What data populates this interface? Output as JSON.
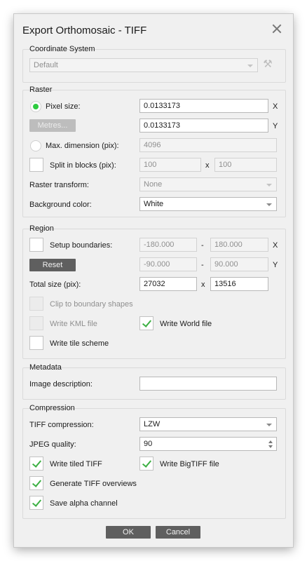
{
  "dialog": {
    "title": "Export Orthomosaic - TIFF",
    "ok_label": "OK",
    "cancel_label": "Cancel"
  },
  "coordinate_system": {
    "group_label": "Coordinate System",
    "value": "Default"
  },
  "raster": {
    "group_label": "Raster",
    "pixel_size_label": "Pixel size:",
    "pixel_size_selected": true,
    "pixel_x": "0.0133173",
    "pixel_y": "0.0133173",
    "metres_button": "Metres...",
    "x_axis": "X",
    "y_axis": "Y",
    "max_dimension_label": "Max. dimension (pix):",
    "max_dimension_value": "4096",
    "split_blocks_label": "Split in blocks (pix):",
    "split_x": "100",
    "split_sep": "x",
    "split_y": "100",
    "raster_transform_label": "Raster transform:",
    "raster_transform_value": "None",
    "background_color_label": "Background color:",
    "background_color_value": "White"
  },
  "region": {
    "group_label": "Region",
    "setup_boundaries_label": "Setup boundaries:",
    "x_min": "-180.000",
    "x_max": "180.000",
    "dash": "-",
    "x_axis": "X",
    "reset_button": "Reset",
    "y_min": "-90.000",
    "y_max": "90.000",
    "y_axis": "Y",
    "total_size_label": "Total size (pix):",
    "total_w": "27032",
    "total_sep": "x",
    "total_h": "13516",
    "clip_label": "Clip to boundary shapes",
    "kml_label": "Write KML file",
    "world_file_label": "Write World file",
    "world_file_checked": true,
    "tile_scheme_label": "Write tile scheme"
  },
  "metadata": {
    "group_label": "Metadata",
    "image_description_label": "Image description:",
    "image_description_value": ""
  },
  "compression": {
    "group_label": "Compression",
    "tiff_compression_label": "TIFF compression:",
    "tiff_compression_value": "LZW",
    "jpeg_quality_label": "JPEG quality:",
    "jpeg_quality_value": "90",
    "write_tiled_label": "Write tiled TIFF",
    "write_bigtiff_label": "Write BigTIFF file",
    "generate_overviews_label": "Generate TIFF overviews",
    "save_alpha_label": "Save alpha channel"
  },
  "colors": {
    "accent_check": "#3cb043",
    "radio_selected": "#2ecc40",
    "button_bg": "#5f5f5f"
  }
}
